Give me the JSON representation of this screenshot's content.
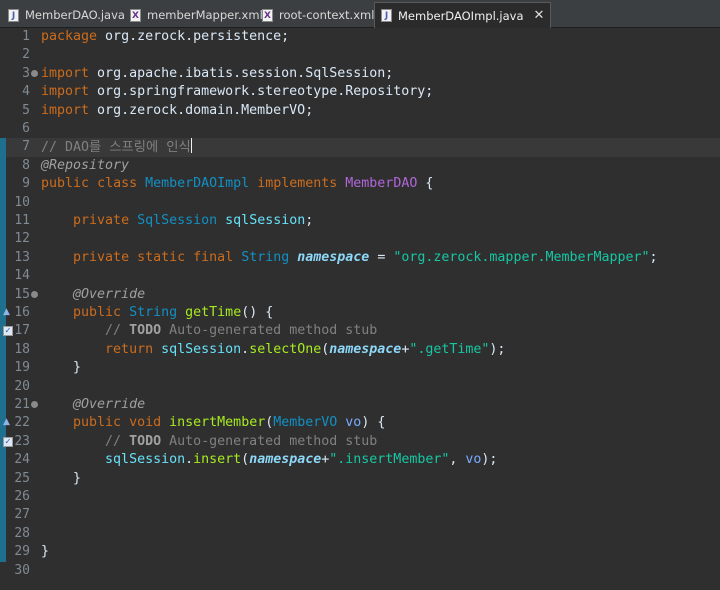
{
  "tabs": [
    {
      "label": "MemberDAO.java",
      "icon": "java-file-icon",
      "badge": "J",
      "kind": "java",
      "active": false
    },
    {
      "label": "memberMapper.xml",
      "icon": "xml-file-icon",
      "badge": "X",
      "kind": "xml",
      "active": false
    },
    {
      "label": "root-context.xml",
      "icon": "xml-file-icon",
      "badge": "X",
      "kind": "xml",
      "active": false
    },
    {
      "label": "MemberDAOImpl.java",
      "icon": "java-file-icon",
      "badge": "J",
      "kind": "java",
      "active": true,
      "close": "✕"
    }
  ],
  "editor": {
    "cursor_line": 7,
    "lines": [
      {
        "n": "1",
        "tokens": [
          [
            "kw",
            "package"
          ],
          [
            "plain",
            " org.zerock.persistence;"
          ]
        ]
      },
      {
        "n": "2",
        "tokens": []
      },
      {
        "n": "3",
        "fold": true,
        "tokens": [
          [
            "kw",
            "import"
          ],
          [
            "plain",
            " org.apache.ibatis.session.SqlSession;"
          ]
        ]
      },
      {
        "n": "4",
        "tokens": [
          [
            "kw",
            "import"
          ],
          [
            "plain",
            " org.springframework.stereotype.Repository;"
          ]
        ]
      },
      {
        "n": "5",
        "tokens": [
          [
            "kw",
            "import"
          ],
          [
            "plain",
            " org.zerock.domain.MemberVO;"
          ]
        ]
      },
      {
        "n": "6",
        "tokens": []
      },
      {
        "n": "7",
        "changed": true,
        "caret": true,
        "tokens": [
          [
            "comment",
            "// DAO를 스프링에 인식"
          ]
        ]
      },
      {
        "n": "8",
        "changed": true,
        "tokens": [
          [
            "anno",
            "@Repository"
          ]
        ]
      },
      {
        "n": "9",
        "changed": true,
        "tokens": [
          [
            "kw",
            "public"
          ],
          [
            "plain",
            " "
          ],
          [
            "kw",
            "class"
          ],
          [
            "plain",
            " "
          ],
          [
            "type",
            "MemberDAOImpl"
          ],
          [
            "plain",
            " "
          ],
          [
            "kw",
            "implements"
          ],
          [
            "plain",
            " "
          ],
          [
            "iface",
            "MemberDAO"
          ],
          [
            "plain",
            " {"
          ]
        ]
      },
      {
        "n": "10",
        "changed": true,
        "tokens": []
      },
      {
        "n": "11",
        "changed": true,
        "tokens": [
          [
            "plain",
            "    "
          ],
          [
            "kw",
            "private"
          ],
          [
            "plain",
            " "
          ],
          [
            "type",
            "SqlSession"
          ],
          [
            "plain",
            " "
          ],
          [
            "field",
            "sqlSession"
          ],
          [
            "plain",
            ";"
          ]
        ]
      },
      {
        "n": "12",
        "changed": true,
        "tokens": []
      },
      {
        "n": "13",
        "changed": true,
        "tokens": [
          [
            "plain",
            "    "
          ],
          [
            "kw",
            "private"
          ],
          [
            "plain",
            " "
          ],
          [
            "kw",
            "static"
          ],
          [
            "plain",
            " "
          ],
          [
            "kw",
            "final"
          ],
          [
            "plain",
            " "
          ],
          [
            "type",
            "String"
          ],
          [
            "plain",
            " "
          ],
          [
            "sfield",
            "namespace"
          ],
          [
            "plain",
            " = "
          ],
          [
            "str",
            "\"org.zerock.mapper.MemberMapper\""
          ],
          [
            "plain",
            ";"
          ]
        ]
      },
      {
        "n": "14",
        "changed": true,
        "tokens": []
      },
      {
        "n": "15",
        "changed": true,
        "fold": true,
        "tokens": [
          [
            "plain",
            "    "
          ],
          [
            "anno",
            "@Override"
          ]
        ]
      },
      {
        "n": "16",
        "changed": true,
        "marker": "override",
        "tokens": [
          [
            "plain",
            "    "
          ],
          [
            "kw",
            "public"
          ],
          [
            "plain",
            " "
          ],
          [
            "type",
            "String"
          ],
          [
            "plain",
            " "
          ],
          [
            "method",
            "getTime"
          ],
          [
            "plain",
            "() {"
          ]
        ]
      },
      {
        "n": "17",
        "changed": true,
        "marker": "task",
        "tokens": [
          [
            "plain",
            "        "
          ],
          [
            "comment",
            "// "
          ],
          [
            "todo",
            "TODO"
          ],
          [
            "comment",
            " Auto-generated method stub"
          ]
        ]
      },
      {
        "n": "18",
        "changed": true,
        "tokens": [
          [
            "plain",
            "        "
          ],
          [
            "kw",
            "return"
          ],
          [
            "plain",
            " "
          ],
          [
            "field",
            "sqlSession"
          ],
          [
            "plain",
            "."
          ],
          [
            "method",
            "selectOne"
          ],
          [
            "plain",
            "("
          ],
          [
            "sfield",
            "namespace"
          ],
          [
            "plain",
            "+"
          ],
          [
            "str",
            "\".getTime\""
          ],
          [
            "plain",
            ");"
          ]
        ]
      },
      {
        "n": "19",
        "changed": true,
        "tokens": [
          [
            "plain",
            "    }"
          ]
        ]
      },
      {
        "n": "20",
        "changed": true,
        "tokens": []
      },
      {
        "n": "21",
        "changed": true,
        "fold": true,
        "tokens": [
          [
            "plain",
            "    "
          ],
          [
            "anno",
            "@Override"
          ]
        ]
      },
      {
        "n": "22",
        "changed": true,
        "marker": "override",
        "tokens": [
          [
            "plain",
            "    "
          ],
          [
            "kw",
            "public"
          ],
          [
            "plain",
            " "
          ],
          [
            "kw",
            "void"
          ],
          [
            "plain",
            " "
          ],
          [
            "method",
            "insertMember"
          ],
          [
            "plain",
            "("
          ],
          [
            "type",
            "MemberVO"
          ],
          [
            "plain",
            " "
          ],
          [
            "param",
            "vo"
          ],
          [
            "plain",
            ") {"
          ]
        ]
      },
      {
        "n": "23",
        "changed": true,
        "marker": "task",
        "tokens": [
          [
            "plain",
            "        "
          ],
          [
            "comment",
            "// "
          ],
          [
            "todo",
            "TODO"
          ],
          [
            "comment",
            " Auto-generated method stub"
          ]
        ]
      },
      {
        "n": "24",
        "changed": true,
        "tokens": [
          [
            "plain",
            "        "
          ],
          [
            "field",
            "sqlSession"
          ],
          [
            "plain",
            "."
          ],
          [
            "method",
            "insert"
          ],
          [
            "plain",
            "("
          ],
          [
            "sfield",
            "namespace"
          ],
          [
            "plain",
            "+"
          ],
          [
            "str",
            "\".insertMember\""
          ],
          [
            "plain",
            ", "
          ],
          [
            "param",
            "vo"
          ],
          [
            "plain",
            ");"
          ]
        ]
      },
      {
        "n": "25",
        "changed": true,
        "tokens": [
          [
            "plain",
            "    }"
          ]
        ]
      },
      {
        "n": "26",
        "changed": true,
        "tokens": []
      },
      {
        "n": "27",
        "changed": true,
        "tokens": []
      },
      {
        "n": "28",
        "changed": true,
        "tokens": []
      },
      {
        "n": "29",
        "changed": true,
        "tokens": [
          [
            "plain",
            "}"
          ]
        ]
      },
      {
        "n": "30",
        "tokens": []
      }
    ]
  }
}
